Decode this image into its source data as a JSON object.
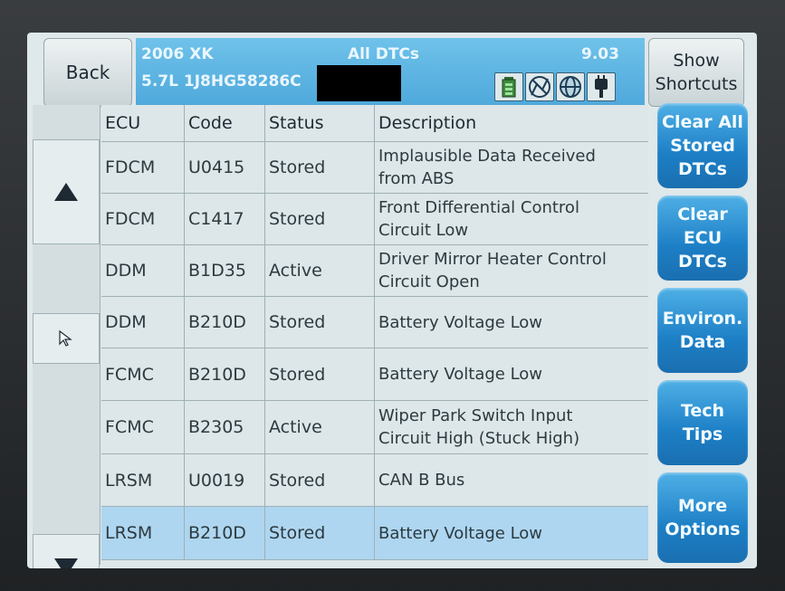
{
  "header": {
    "back_label": "Back",
    "model": "2006 XK",
    "vin": "5.7L 1J8HG58286C",
    "title": "All DTCs",
    "version": "9.03",
    "shortcuts_line1": "Show",
    "shortcuts_line2": "Shortcuts",
    "status_icons": [
      "battery-icon",
      "no-signal-icon",
      "network-icon",
      "plug-icon"
    ]
  },
  "table": {
    "columns": [
      "ECU",
      "Code",
      "Status",
      "Description"
    ],
    "rows": [
      {
        "ecu": "FDCM",
        "code": "U0415",
        "status": "Stored",
        "desc1": "Implausible Data Received",
        "desc2": "from ABS"
      },
      {
        "ecu": "FDCM",
        "code": "C1417",
        "status": "Stored",
        "desc1": "Front Differential Control",
        "desc2": "Circuit Low"
      },
      {
        "ecu": "DDM",
        "code": "B1D35",
        "status": "Active",
        "desc1": "Driver Mirror Heater Control",
        "desc2": "Circuit Open"
      },
      {
        "ecu": "DDM",
        "code": "B210D",
        "status": "Stored",
        "desc1": "Battery Voltage Low",
        "desc2": ""
      },
      {
        "ecu": "FCMC",
        "code": "B210D",
        "status": "Stored",
        "desc1": "Battery Voltage Low",
        "desc2": ""
      },
      {
        "ecu": "FCMC",
        "code": "B2305",
        "status": "Active",
        "desc1": "Wiper Park Switch Input",
        "desc2": "Circuit High (Stuck High)"
      },
      {
        "ecu": "LRSM",
        "code": "U0019",
        "status": "Stored",
        "desc1": "CAN B Bus",
        "desc2": ""
      },
      {
        "ecu": "LRSM",
        "code": "B210D",
        "status": "Stored",
        "desc1": "Battery Voltage Low",
        "desc2": ""
      }
    ]
  },
  "actions": {
    "clear_all": [
      "Clear All",
      "Stored",
      "DTCs"
    ],
    "clear_ecu": [
      "Clear",
      "ECU",
      "DTCs"
    ],
    "environ": [
      "Environ.",
      "Data"
    ],
    "tech_tips": [
      "Tech",
      "Tips"
    ],
    "more_options": [
      "More",
      "Options"
    ]
  },
  "colors": {
    "header_blue": "#5cb4e2",
    "button_blue": "#1d7fc6",
    "selected_row": "#aed6f0"
  }
}
